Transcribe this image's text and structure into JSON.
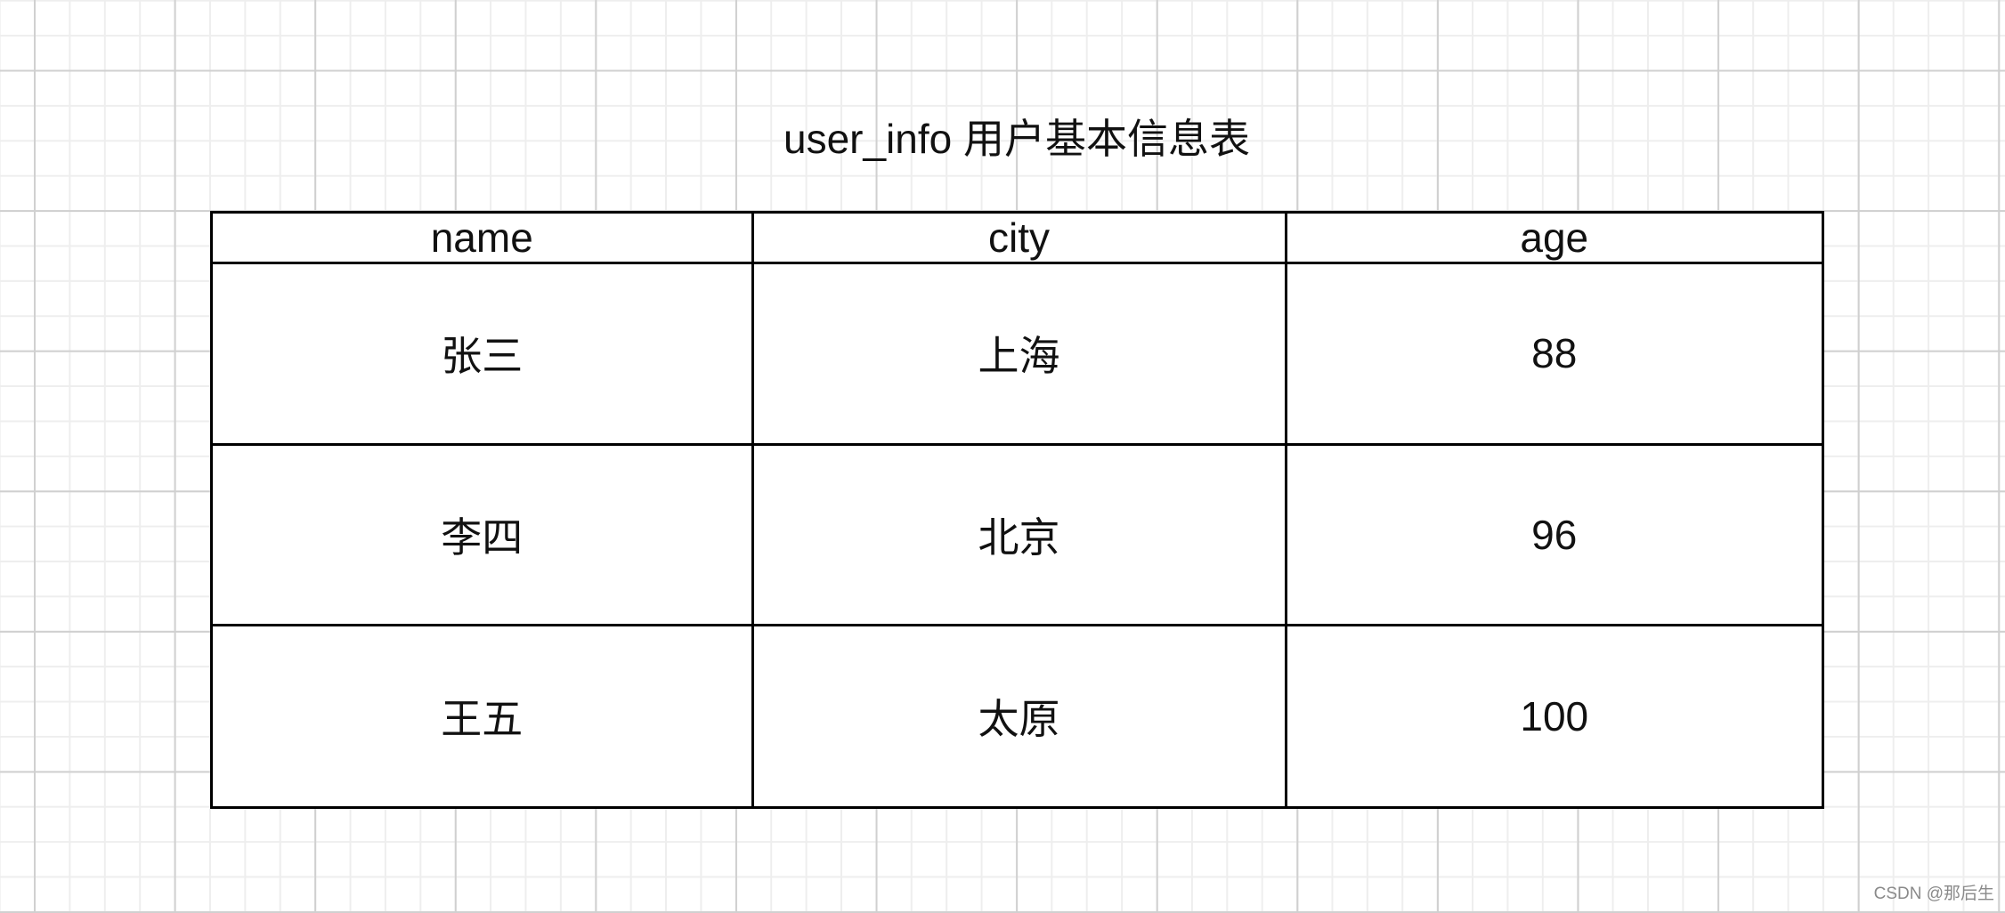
{
  "diagram": {
    "title": "user_info 用户基本信息表",
    "table": {
      "columns": [
        "name",
        "city",
        "age"
      ],
      "rows": [
        [
          "张三",
          "上海",
          "88"
        ],
        [
          "李四",
          "北京",
          "96"
        ],
        [
          "王五",
          "太原",
          "100"
        ]
      ]
    }
  },
  "watermark": "CSDN @那后生",
  "colors": {
    "border": "#000000",
    "grid_major": "#d0d0d0",
    "grid_minor": "#eeeeee",
    "watermark_text": "#8a8a8a"
  }
}
